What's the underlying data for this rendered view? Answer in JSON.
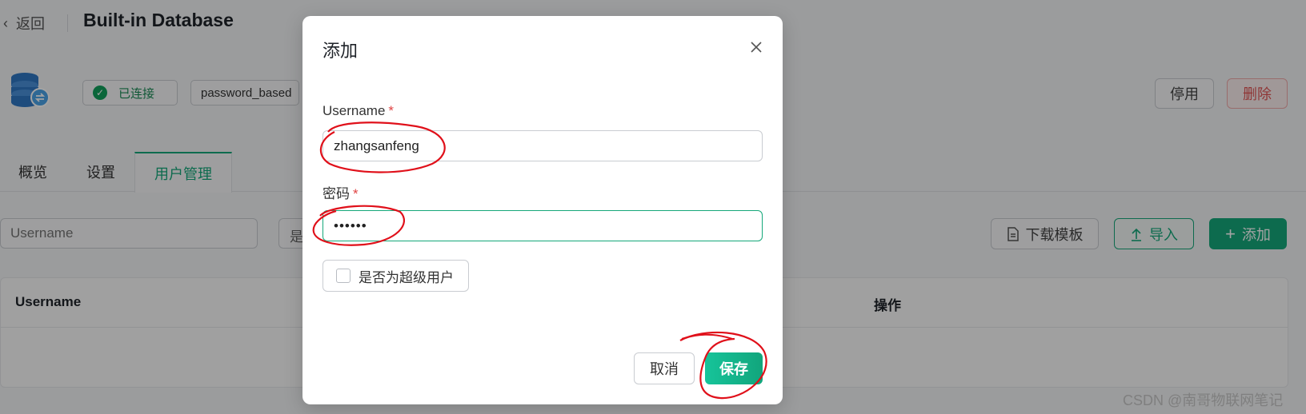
{
  "header": {
    "back_label": "返回",
    "title": "Built-in Database"
  },
  "status": {
    "connected_label": "已连接",
    "auth_label": "password_based"
  },
  "actions": {
    "disable_label": "停用",
    "delete_label": "删除"
  },
  "tabs": [
    {
      "label": "概览"
    },
    {
      "label": "设置"
    },
    {
      "label": "用户管理",
      "active": true
    }
  ],
  "toolbar": {
    "search_placeholder": "Username",
    "filter_partial": "是",
    "template_label": "下载模板",
    "import_label": "导入",
    "add_label": "添加"
  },
  "table": {
    "columns": [
      "Username",
      "操作"
    ]
  },
  "dialog": {
    "title": "添加",
    "username_label": "Username",
    "username_value": "zhangsanfeng",
    "password_label": "密码",
    "password_value": "••••••",
    "required_mark": "*",
    "superuser_label": "是否为超级用户",
    "cancel_label": "取消",
    "save_label": "保存"
  },
  "watermark": "CSDN @南哥物联网笔记",
  "colors": {
    "accent": "#15a87a",
    "danger": "#e05555",
    "annotation": "#e0101a"
  }
}
